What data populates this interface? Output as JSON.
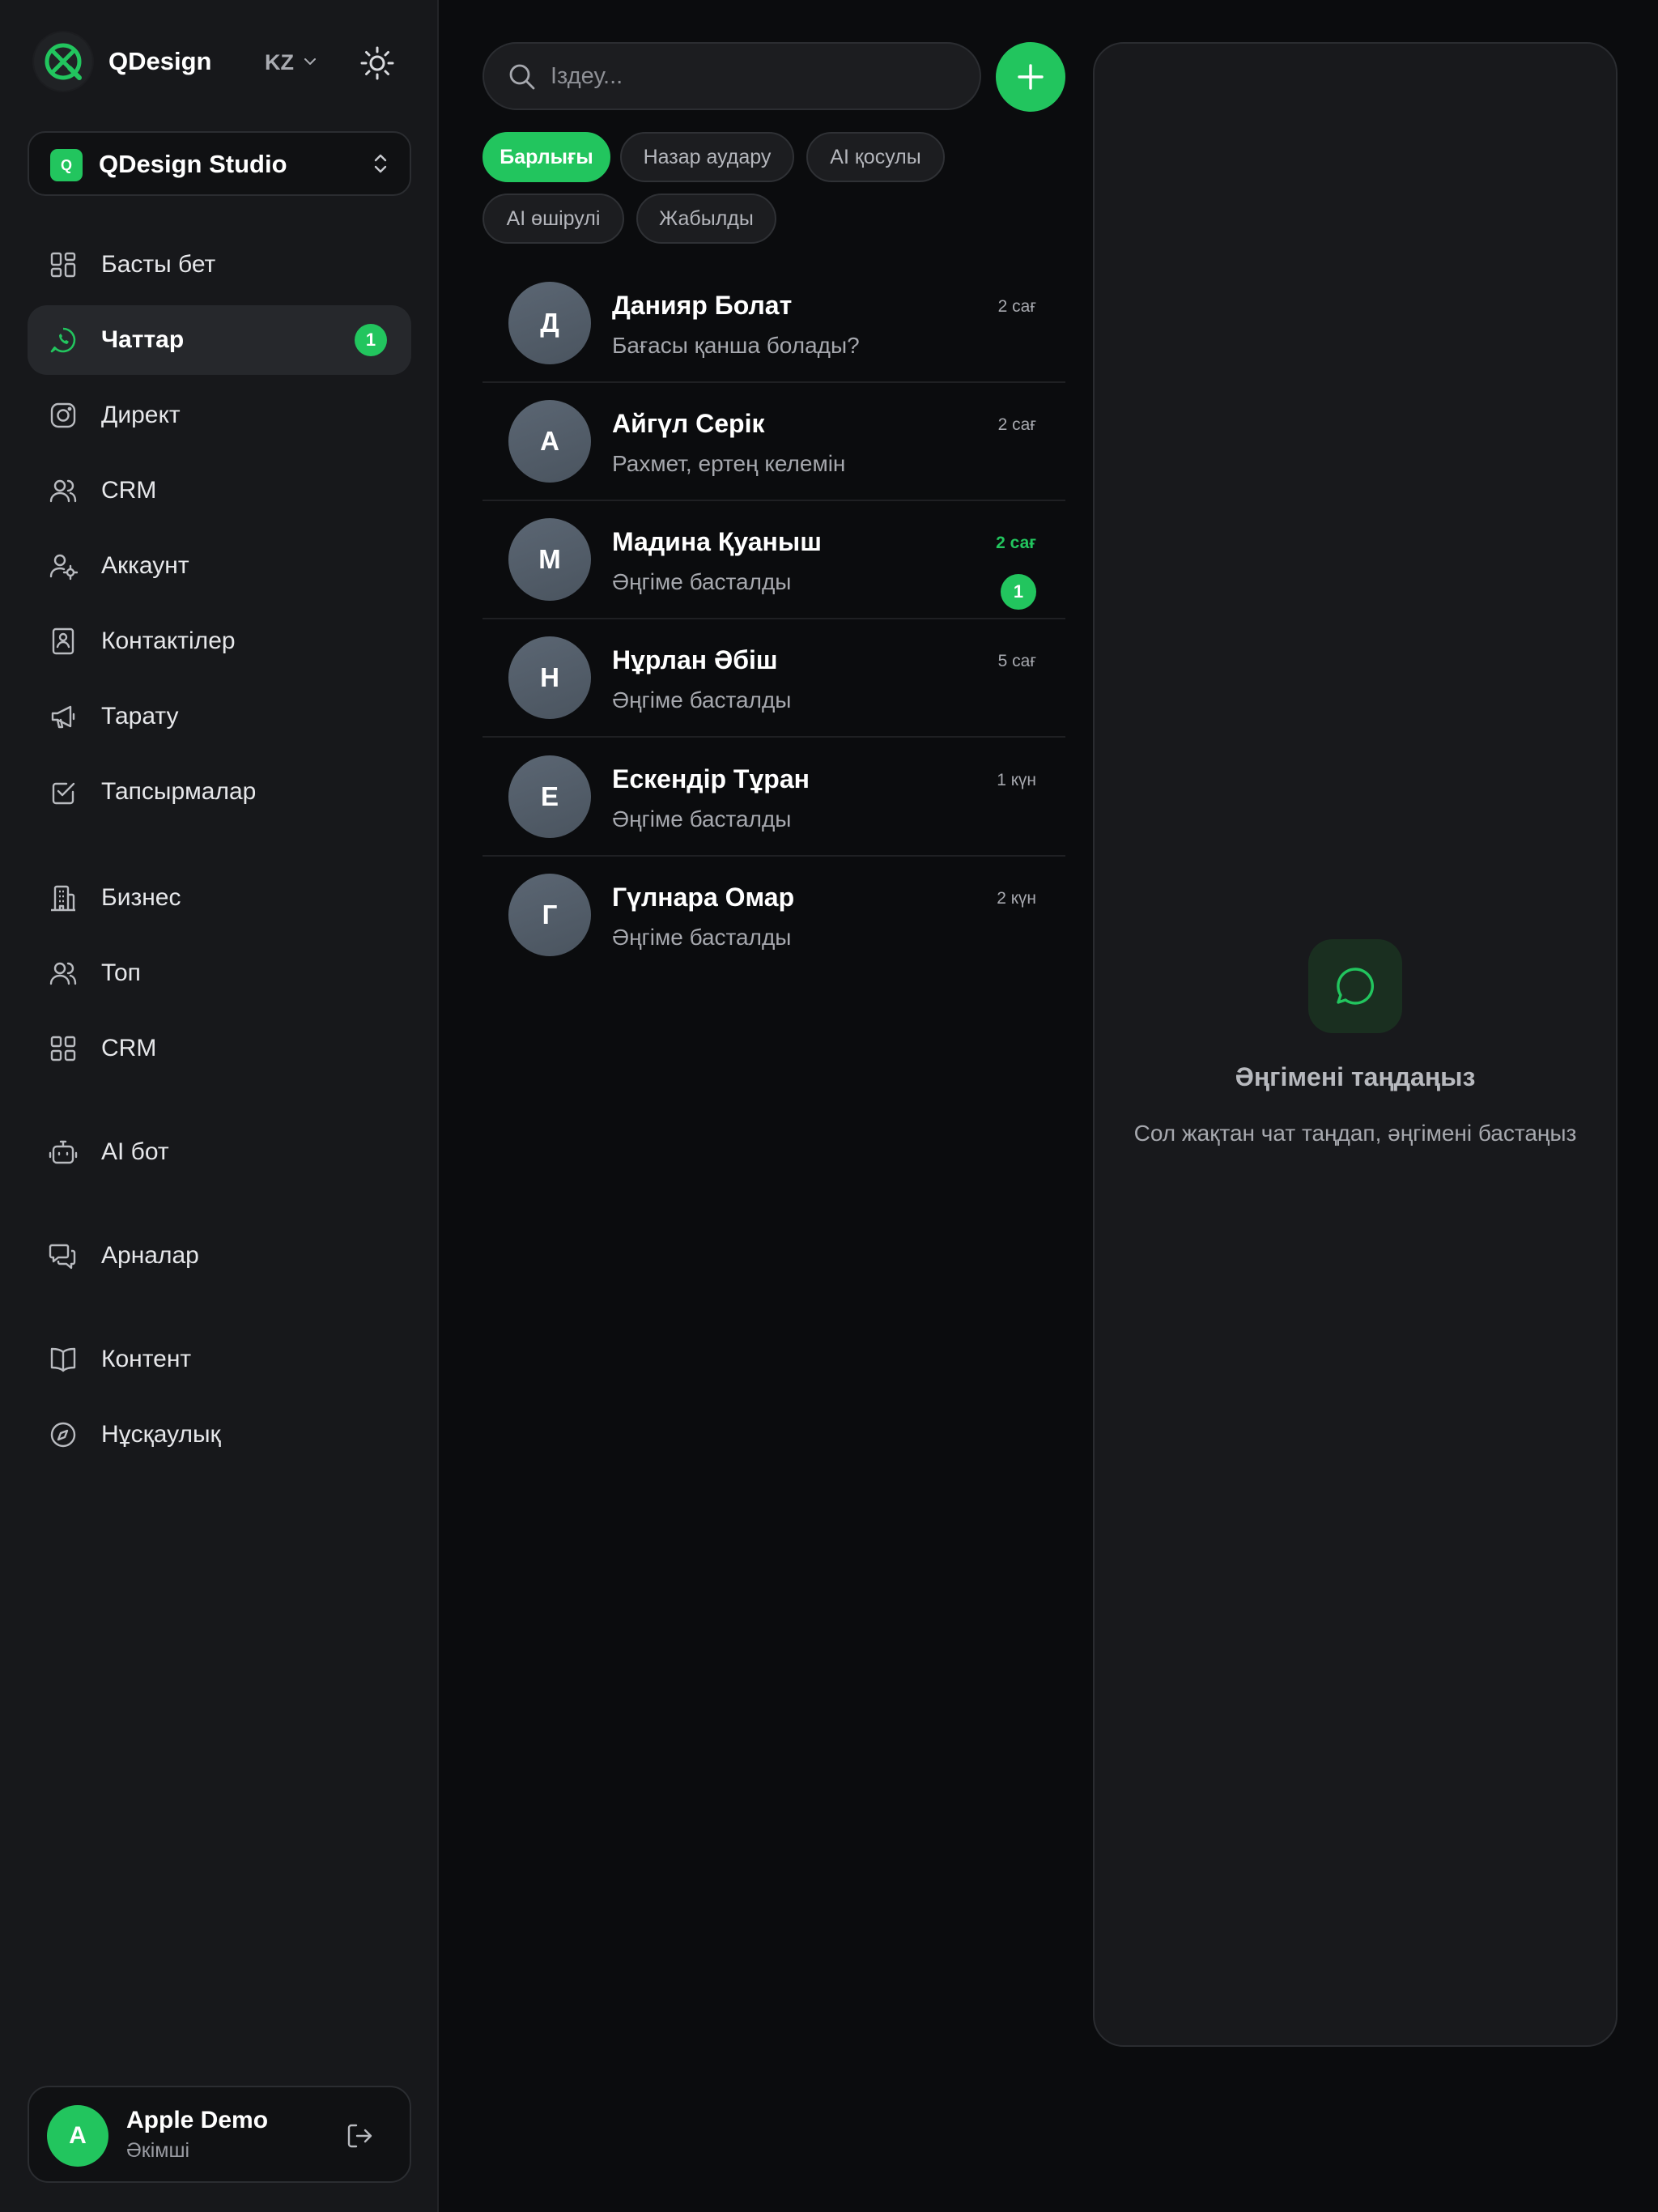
{
  "brand": {
    "name": "QDesign",
    "language": "KZ"
  },
  "workspace": {
    "icon_letter": "Q",
    "name": "QDesign Studio"
  },
  "nav": [
    {
      "label": "Басты бет",
      "icon": "dashboard-icon"
    },
    {
      "label": "Чаттар",
      "icon": "whatsapp-icon",
      "active": true,
      "badge": "1"
    },
    {
      "label": "Директ",
      "icon": "instagram-icon"
    },
    {
      "label": "CRM",
      "icon": "users-icon"
    },
    {
      "label": "Аккаунт",
      "icon": "user-settings-icon"
    },
    {
      "label": "Контактілер",
      "icon": "contact-book-icon"
    },
    {
      "label": "Тарату",
      "icon": "megaphone-icon"
    },
    {
      "label": "Тапсырмалар",
      "icon": "checkbox-icon"
    },
    {
      "label": "Бизнес",
      "icon": "building-icon"
    },
    {
      "label": "Топ",
      "icon": "group-icon"
    },
    {
      "label": "CRM",
      "icon": "grid-icon"
    },
    {
      "label": "AI бот",
      "icon": "bot-icon"
    },
    {
      "label": "Арналар",
      "icon": "messages-icon"
    },
    {
      "label": "Контент",
      "icon": "book-icon"
    },
    {
      "label": "Нұсқаулық",
      "icon": "compass-icon"
    }
  ],
  "user": {
    "initial": "A",
    "name": "Apple Demo",
    "role": "Әкімші"
  },
  "search": {
    "placeholder": "Іздеу..."
  },
  "filters": [
    "Барлығы",
    "Назар аудару",
    "AI қосулы",
    "AI өшірулі",
    "Жабылды"
  ],
  "conversations": [
    {
      "initial": "Д",
      "name": "Данияр Болат",
      "preview": "Бағасы қанша болады?",
      "time": "2 сағ"
    },
    {
      "initial": "А",
      "name": "Айгүл Серік",
      "preview": "Рахмет, ертең келемін",
      "time": "2 сағ"
    },
    {
      "initial": "М",
      "name": "Мадина Қуаныш",
      "preview": "Әңгіме басталды",
      "time": "2 сағ",
      "unread": "1"
    },
    {
      "initial": "Н",
      "name": "Нұрлан Әбіш",
      "preview": "Әңгіме басталды",
      "time": "5 сағ"
    },
    {
      "initial": "Е",
      "name": "Ескендір Тұран",
      "preview": "Әңгіме басталды",
      "time": "1 күн"
    },
    {
      "initial": "Г",
      "name": "Гүлнара Омар",
      "preview": "Әңгіме басталды",
      "time": "2 күн"
    }
  ],
  "empty_state": {
    "title": "Әңгімені таңдаңыз",
    "subtitle": "Сол жақтан чат таңдап, әңгімені бастаңыз"
  },
  "colors": {
    "accent": "#22c55e",
    "background": "#0b0c0e",
    "sidebar": "#17181b"
  }
}
